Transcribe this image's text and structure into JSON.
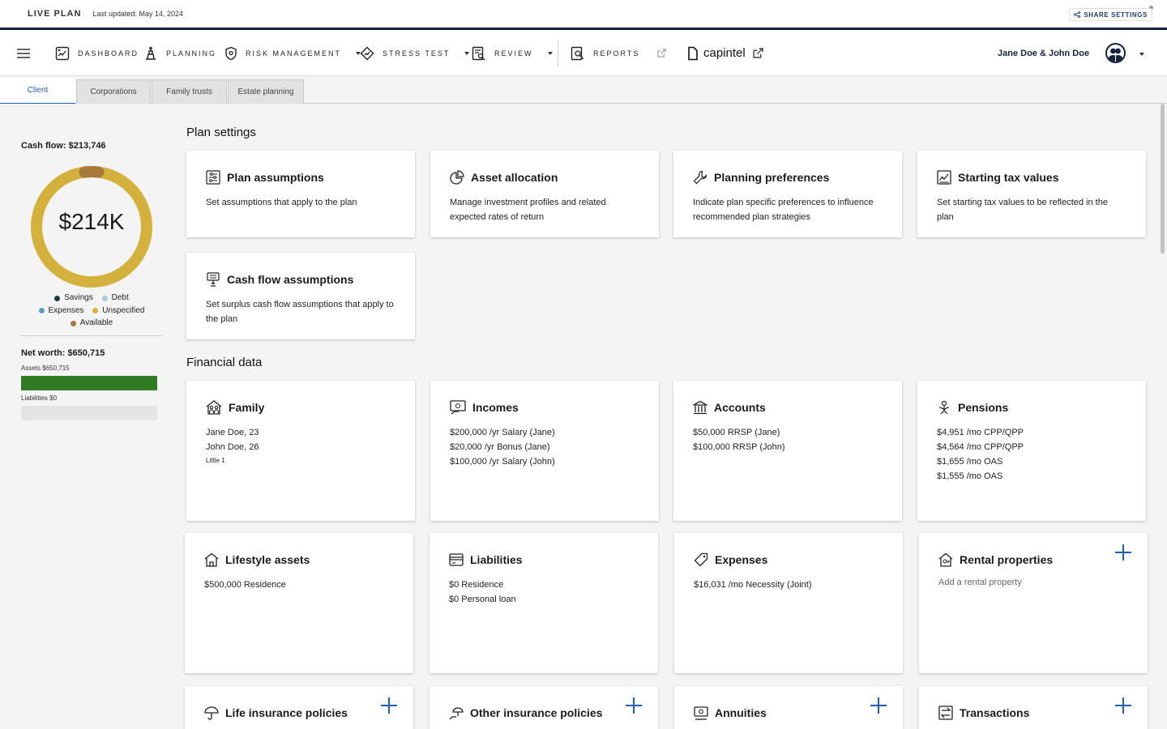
{
  "top": {
    "live_plan": "LIVE PLAN",
    "last_updated": "Last updated: May 14, 2024",
    "share_settings": "SHARE SETTINGS"
  },
  "nav": {
    "items": [
      {
        "label": "DASHBOARD",
        "icon": "dashboard-icon"
      },
      {
        "label": "PLANNING",
        "icon": "planning-icon"
      },
      {
        "label": "RISK MANAGEMENT",
        "icon": "shield-icon"
      },
      {
        "label": "STRESS TEST",
        "icon": "stress-test-icon"
      },
      {
        "label": "REVIEW",
        "icon": "review-icon"
      },
      {
        "label": "REPORTS",
        "icon": "reports-icon"
      }
    ],
    "brand": "capintel",
    "user": "Jane Doe & John Doe"
  },
  "tabs": [
    "Client",
    "Corporations",
    "Family trusts",
    "Estate planning"
  ],
  "sidebar": {
    "cash_flow_title": "Cash flow: $213,746",
    "cash_flow_center": "$214K",
    "legend": [
      {
        "label": "Savings",
        "color": "#1f3a3e"
      },
      {
        "label": "Debt",
        "color": "#a8cdd8"
      },
      {
        "label": "Expenses",
        "color": "#5b9ecb"
      },
      {
        "label": "Unspecified",
        "color": "#d4b13c"
      },
      {
        "label": "Available",
        "color": "#a77a3c"
      }
    ],
    "donut": {
      "unspecified_share": 0.96,
      "available_share": 0.04,
      "unspecified_color": "#d4b13c",
      "available_color": "#a77a3c"
    },
    "net_worth_title": "Net worth: $650,715",
    "assets_label": "Assets $650,715",
    "assets_fill": 1.0,
    "liabilities_label": "Liabilities $0",
    "liabilities_fill": 0.0
  },
  "plan_settings": {
    "title": "Plan settings",
    "cards": [
      {
        "title": "Plan assumptions",
        "desc": "Set assumptions that apply to the plan",
        "icon": "sliders-icon"
      },
      {
        "title": "Asset allocation",
        "desc": "Manage investment profiles and related expected rates of return",
        "icon": "pie-chart-icon"
      },
      {
        "title": "Planning preferences",
        "desc": "Indicate plan specific preferences to influence recommended plan strategies",
        "icon": "wrench-icon"
      },
      {
        "title": "Starting tax values",
        "desc": "Set starting tax values to be reflected in the plan",
        "icon": "tax-chart-icon"
      },
      {
        "title": "Cash flow assumptions",
        "desc": "Set surplus cash flow assumptions that apply to the plan",
        "icon": "cash-flow-icon"
      }
    ]
  },
  "financial_data": {
    "title": "Financial data",
    "family": {
      "title": "Family",
      "lines": [
        "Jane Doe, 23",
        "John Doe, 26"
      ],
      "small": "Little 1"
    },
    "incomes": {
      "title": "Incomes",
      "lines": [
        "$200,000 /yr Salary (Jane)",
        "$20,000 /yr Bonus (Jane)",
        "$100,000 /yr Salary (John)"
      ]
    },
    "accounts": {
      "title": "Accounts",
      "lines": [
        "$50,000 RRSP (Jane)",
        "$100,000 RRSP (John)"
      ]
    },
    "pensions": {
      "title": "Pensions",
      "lines": [
        "$4,951 /mo CPP/QPP",
        "$4,564 /mo CPP/QPP",
        "$1,655 /mo OAS",
        "$1,555 /mo OAS"
      ]
    },
    "lifestyle": {
      "title": "Lifestyle assets",
      "lines": [
        "$500,000 Residence"
      ]
    },
    "liabilities": {
      "title": "Liabilities",
      "lines": [
        "$0 Residence",
        "$0 Personal loan"
      ]
    },
    "expenses": {
      "title": "Expenses",
      "lines": [
        "$16,031 /mo Necessity (Joint)"
      ]
    },
    "rental": {
      "title": "Rental properties",
      "placeholder": "Add a rental property"
    },
    "life_insurance": {
      "title": "Life insurance policies"
    },
    "other_insurance": {
      "title": "Other insurance policies"
    },
    "annuities": {
      "title": "Annuities"
    },
    "transactions": {
      "title": "Transactions"
    }
  }
}
